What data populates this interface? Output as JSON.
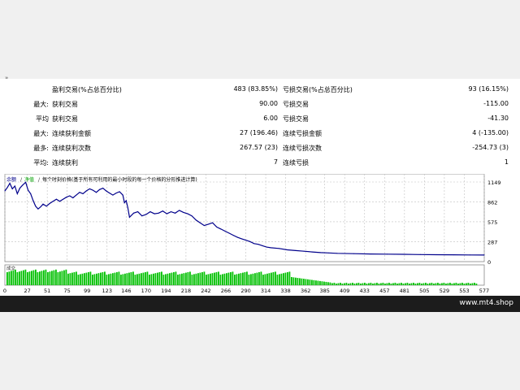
{
  "corner_mark": "»",
  "stats": [
    {
      "prefix": "",
      "label1": "盈利交易(%占总百分比)",
      "value1": "483 (83.85%)",
      "label2": "亏损交易(%占总百分比)",
      "value2": "93 (16.15%)"
    },
    {
      "prefix": "最大:",
      "label1": "获利交易",
      "value1": "90.00",
      "label2": "亏损交易",
      "value2": "-115.00"
    },
    {
      "prefix": "平均",
      "label1": "获利交易",
      "value1": "6.00",
      "label2": "亏损交易",
      "value2": "-41.30"
    },
    {
      "prefix": "最大:",
      "label1": "连续获利金额",
      "value1": "27 (196.46)",
      "label2": "连续亏损金额",
      "value2": "4 (-135.00)"
    },
    {
      "prefix": "最多:",
      "label1": "连续获利次数",
      "value1": "267.57 (23)",
      "label2": "连续亏损次数",
      "value2": "-254.73 (3)"
    },
    {
      "prefix": "平均:",
      "label1": "连续获利",
      "value1": "7",
      "label2": "连续亏损",
      "value2": "1"
    }
  ],
  "chart_data": {
    "type": "line",
    "legend": [
      "余额",
      "净值"
    ],
    "note": "每个时刻价格(基于所有可利用的最小时段的每一个价格的分形推进计算)",
    "x_ticks": [
      0,
      27,
      51,
      75,
      99,
      123,
      146,
      170,
      194,
      218,
      242,
      266,
      290,
      314,
      338,
      362,
      385,
      409,
      433,
      457,
      481,
      505,
      529,
      553,
      577
    ],
    "y_ticks": [
      1149,
      862,
      575,
      287,
      0
    ],
    "xlim": [
      0,
      577
    ],
    "ylim": [
      0,
      1149
    ],
    "series": [
      {
        "name": "余额",
        "color": "#00008b",
        "x": [
          0,
          3,
          6,
          9,
          12,
          15,
          18,
          21,
          25,
          28,
          31,
          34,
          37,
          40,
          43,
          46,
          50,
          54,
          58,
          62,
          66,
          70,
          74,
          78,
          82,
          86,
          90,
          94,
          98,
          102,
          106,
          110,
          114,
          118,
          122,
          126,
          130,
          134,
          138,
          142,
          144,
          146,
          148,
          150,
          155,
          160,
          165,
          170,
          175,
          180,
          185,
          190,
          195,
          200,
          205,
          210,
          215,
          220,
          225,
          230,
          235,
          240,
          245,
          250,
          255,
          260,
          265,
          270,
          275,
          280,
          285,
          290,
          295,
          300,
          305,
          310,
          315,
          320,
          330,
          340,
          350,
          360,
          370,
          380,
          390,
          400,
          420,
          440,
          460,
          480,
          500,
          520,
          540,
          560,
          577
        ],
        "y": [
          1020,
          1070,
          1130,
          1050,
          1090,
          980,
          1060,
          1100,
          1145,
          1030,
          980,
          880,
          800,
          760,
          790,
          830,
          800,
          840,
          870,
          900,
          870,
          900,
          930,
          950,
          920,
          960,
          1000,
          980,
          1020,
          1050,
          1030,
          1000,
          1040,
          1060,
          1020,
          990,
          960,
          990,
          1010,
          960,
          850,
          880,
          780,
          640,
          700,
          720,
          660,
          680,
          720,
          690,
          700,
          730,
          690,
          720,
          700,
          740,
          710,
          690,
          660,
          600,
          560,
          520,
          540,
          560,
          500,
          470,
          440,
          410,
          380,
          350,
          330,
          310,
          290,
          260,
          250,
          230,
          210,
          200,
          190,
          170,
          160,
          150,
          140,
          130,
          125,
          120,
          115,
          110,
          108,
          105,
          102,
          100,
          98,
          96,
          95
        ]
      }
    ]
  },
  "volume_panel": {
    "label": "成交"
  },
  "site": "www.mt4.shop"
}
